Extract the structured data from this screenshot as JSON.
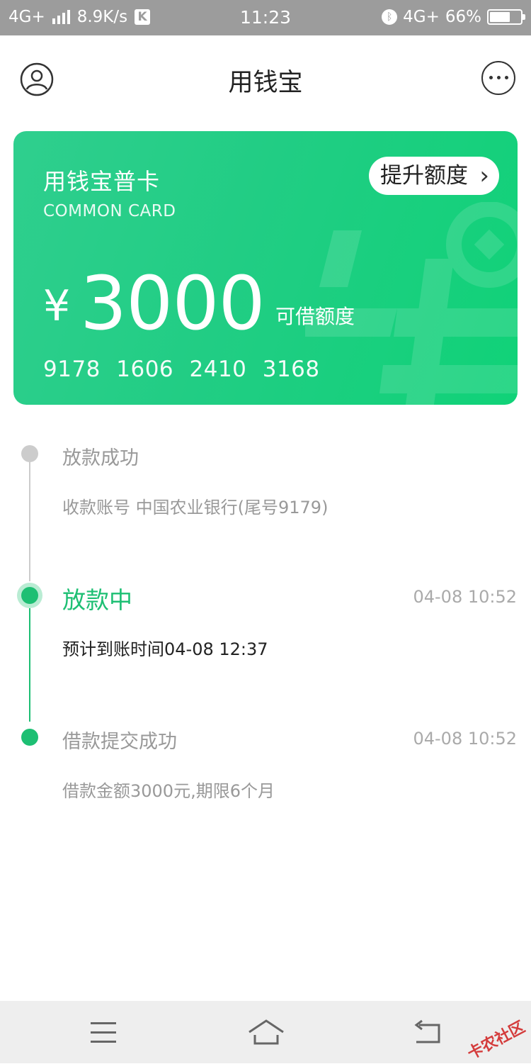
{
  "status_bar": {
    "network_left": "4G+",
    "speed": "8.9K/s",
    "k_badge": "K",
    "time": "11:23",
    "network_right": "4G+",
    "battery_percent": "66%",
    "battery_level": 0.66
  },
  "header": {
    "title": "用钱宝"
  },
  "card": {
    "name": "用钱宝普卡",
    "subtitle": "COMMON CARD",
    "upgrade_label": "提升额度",
    "upgrade_chevron": "›",
    "currency": "¥",
    "amount": "3000",
    "amount_label": "可借额度",
    "card_number": "9178 1606 2410 3168"
  },
  "timeline": [
    {
      "title": "放款成功",
      "description": "收款账号 中国农业银行(尾号9179)",
      "time": "",
      "state": "pending"
    },
    {
      "title": "放款中",
      "description": "预计到账时间04-08 12:37",
      "time": "04-08 10:52",
      "state": "active"
    },
    {
      "title": "借款提交成功",
      "description": "借款金额3000元,期限6个月",
      "time": "04-08 10:52",
      "state": "done"
    }
  ],
  "colors": {
    "accent": "#1dbf73",
    "accent_light": "#a8e9c8",
    "inactive": "#cccccc",
    "text_gray": "#999999"
  },
  "watermark": {
    "text": "卡农社区"
  }
}
